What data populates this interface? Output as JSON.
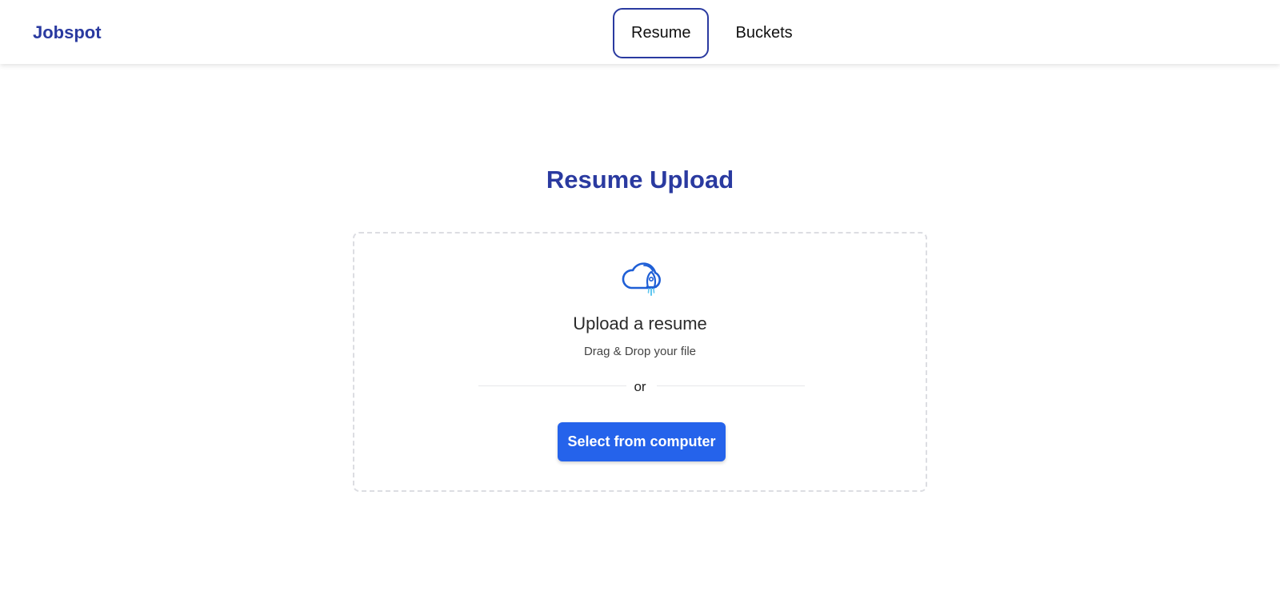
{
  "app": {
    "brand": "Jobspot",
    "brand_color": "#2a3aa0",
    "accent_color": "#2563eb"
  },
  "nav": {
    "tabs": [
      {
        "label": "Resume",
        "active": true
      },
      {
        "label": "Buckets",
        "active": false
      }
    ]
  },
  "main": {
    "title": "Resume Upload",
    "dropzone": {
      "icon": "cloud-rocket-icon",
      "heading": "Upload a resume",
      "subtext": "Drag & Drop your file",
      "divider_text": "or",
      "button_label": "Select from computer"
    }
  }
}
